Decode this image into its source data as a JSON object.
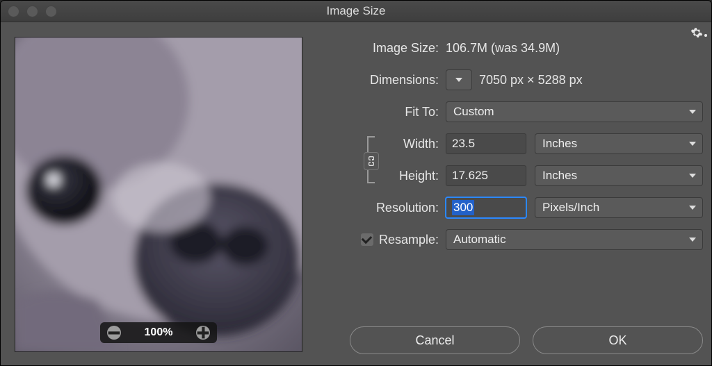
{
  "window": {
    "title": "Image Size"
  },
  "preview": {
    "zoom_label": "100%"
  },
  "labels": {
    "image_size": "Image Size:",
    "dimensions": "Dimensions:",
    "fit_to": "Fit To:",
    "width": "Width:",
    "height": "Height:",
    "resolution": "Resolution:",
    "resample": "Resample:"
  },
  "values": {
    "image_size_text": "106.7M (was 34.9M)",
    "dimensions_text": "7050 px × 5288 px",
    "fit_to": "Custom",
    "width": "23.5",
    "height": "17.625",
    "resolution": "300",
    "resample": "Automatic"
  },
  "units": {
    "width": "Inches",
    "height": "Inches",
    "resolution": "Pixels/Inch"
  },
  "resample_checked": true,
  "buttons": {
    "cancel": "Cancel",
    "ok": "OK"
  }
}
